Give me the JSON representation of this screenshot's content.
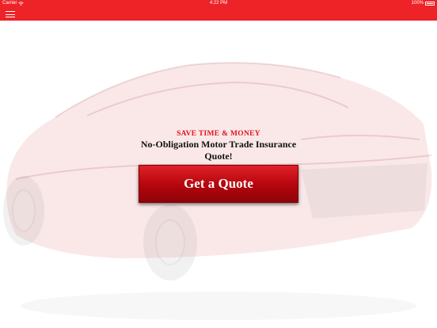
{
  "status_bar": {
    "carrier": "Carrier",
    "time": "4:22 PM",
    "battery": "100%"
  },
  "nav": {
    "menu_icon": "hamburger-menu-icon"
  },
  "main": {
    "tagline": "SAVE TIME & MONEY",
    "headline": "No-Obligation Motor Trade Insurance Quote!",
    "quote_button_label": "Get a Quote"
  },
  "colors": {
    "brand_red": "#ee2328",
    "tagline_red": "#e3121b",
    "button_red": "#b4050d"
  }
}
